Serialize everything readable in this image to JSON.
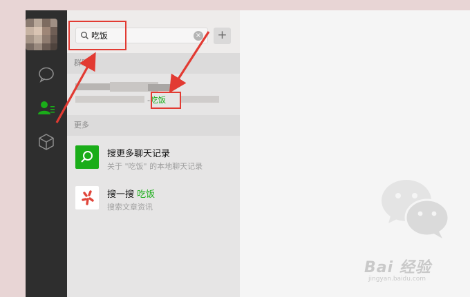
{
  "search": {
    "query": "吃饭",
    "clear_glyph": "×",
    "add_glyph": "+"
  },
  "sections": {
    "group_header": "群聊",
    "more_header": "更多"
  },
  "group_result": {
    "match_prefix": "-",
    "match_keyword": "吃饭"
  },
  "results": [
    {
      "icon": "search-icon",
      "title": "搜更多聊天记录",
      "subtitle": "关于 \"吃饭\" 的本地聊天记录"
    },
    {
      "icon": "search-one-search-icon",
      "title_prefix": "搜一搜 ",
      "title_keyword": "吃饭",
      "subtitle": "搜索文章资讯"
    }
  ],
  "watermark": {
    "brand": "Bai 经验",
    "url": "jingyan.baidu.com"
  },
  "colors": {
    "accent_green": "#1aad19",
    "annotation_red": "#e23a32",
    "rail_bg": "#2e2e2e"
  }
}
